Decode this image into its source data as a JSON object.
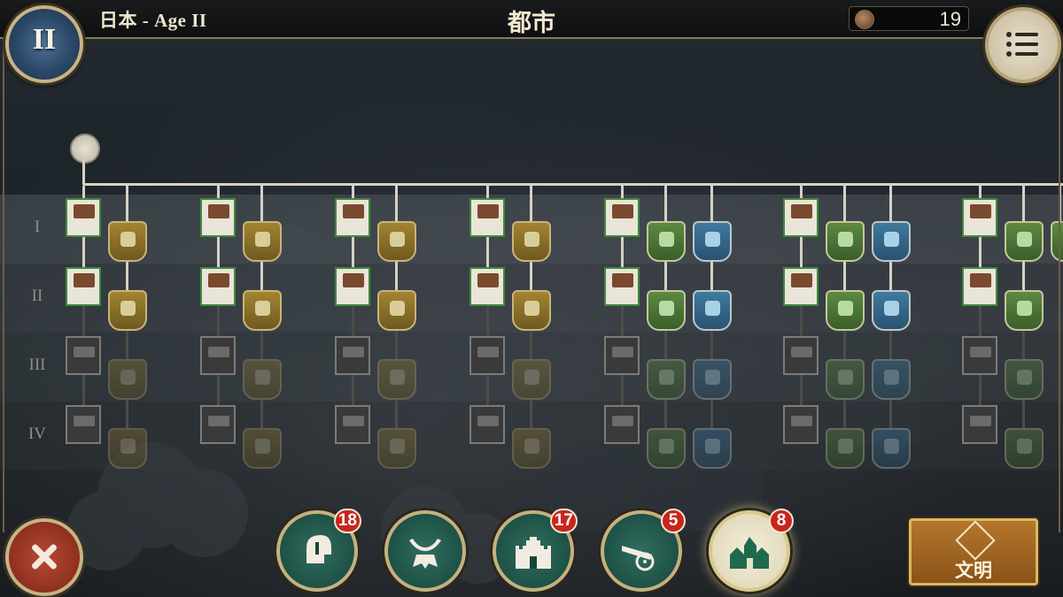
{
  "header": {
    "age_title": "日本 - Age II",
    "screen_title": "都市",
    "age_badge": "II",
    "resource": {
      "icon": "shipment-coin-icon",
      "value": "19"
    },
    "menu_icon": "list-menu-icon"
  },
  "rows": [
    {
      "label": "I"
    },
    {
      "label": "II"
    },
    {
      "label": "III"
    },
    {
      "label": "IV"
    }
  ],
  "tree": {
    "root_icon": "town-center-icon",
    "columns": [
      {
        "card": "house-card",
        "upgrades": [
          "gold"
        ]
      },
      {
        "card": "mill-card",
        "upgrades": [
          "gold"
        ]
      },
      {
        "card": "market-card",
        "upgrades": [
          "gold"
        ]
      },
      {
        "card": "plantation-card",
        "upgrades": [
          "gold"
        ]
      },
      {
        "card": "barracks-card",
        "upgrades": [
          "green",
          "blue"
        ]
      },
      {
        "card": "stable-card",
        "upgrades": [
          "green",
          "blue"
        ]
      },
      {
        "card": "artillery-card",
        "upgrades": [
          "green"
        ]
      }
    ],
    "unlocked_rows": 2
  },
  "bottom": {
    "close_icon": "close-x-icon",
    "categories": [
      {
        "name": "infantry",
        "icon": "helmet-icon",
        "count": "18",
        "active": false
      },
      {
        "name": "cavalry",
        "icon": "horse-armor-icon",
        "count": "",
        "active": false
      },
      {
        "name": "fortress",
        "icon": "castle-icon",
        "count": "17",
        "active": false
      },
      {
        "name": "artillery",
        "icon": "cannon-icon",
        "count": "5",
        "active": false
      },
      {
        "name": "city",
        "icon": "town-house-icon",
        "count": "8",
        "active": true
      }
    ],
    "civ_button": {
      "icon": "civilization-emblem-icon",
      "label": "文明"
    }
  },
  "colors": {
    "accent_gold": "#c6b486",
    "badge_red": "#c8261c",
    "unlocked_border": "#3e8a3c",
    "category_teal": "#17453b"
  }
}
